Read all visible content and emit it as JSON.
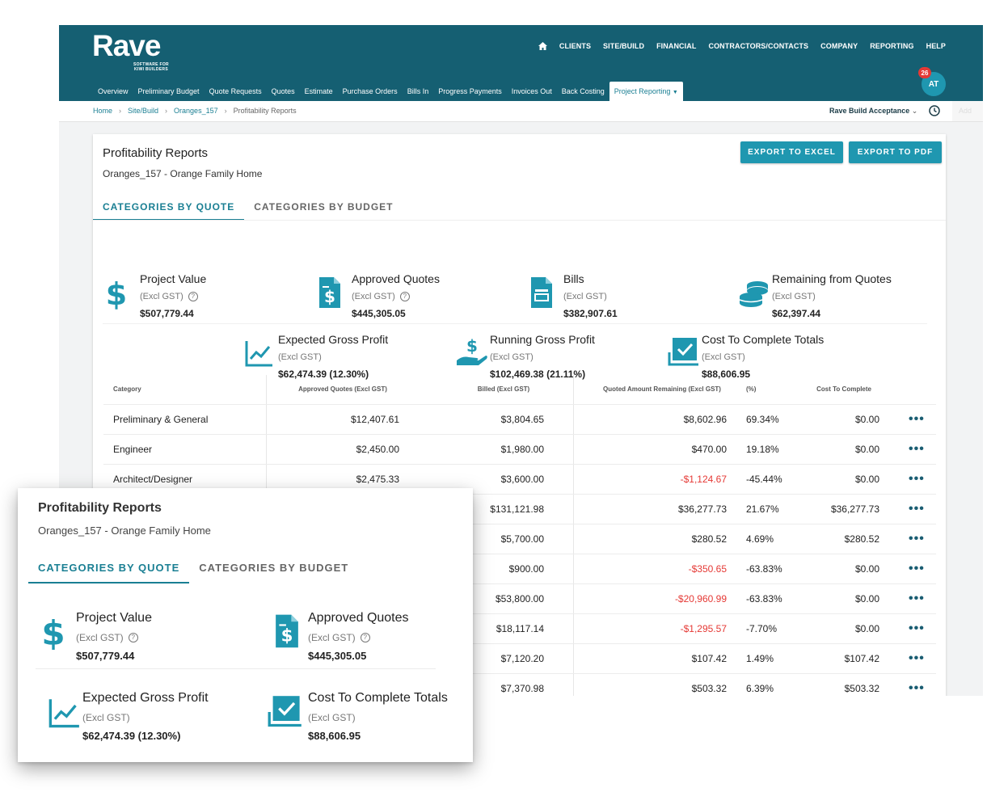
{
  "app": {
    "logo": "Rave",
    "logo_tagline": "SOFTWARE FOR KIWI BUILDERS",
    "main_nav": [
      "CLIENTS",
      "SITE/BUILD",
      "FINANCIAL",
      "CONTRACTORS/CONTACTS",
      "COMPANY",
      "REPORTING",
      "HELP"
    ],
    "sub_nav": [
      "Overview",
      "Preliminary Budget",
      "Quote Requests",
      "Quotes",
      "Estimate",
      "Purchase Orders",
      "Bills In",
      "Progress Payments",
      "Invoices Out",
      "Back Costing",
      "Project Reporting"
    ],
    "sub_nav_active": "Project Reporting",
    "avatar_initials": "AT",
    "notification_count": "26",
    "breadcrumb": [
      "Home",
      "Site/Build",
      "Oranges_157",
      "Profitability Reports"
    ],
    "company_selector": "Rave Build Acceptance",
    "add_tab": "Add",
    "colors": {
      "header": "#155f72",
      "accent": "#1f97b0",
      "negative": "#e53935"
    }
  },
  "report": {
    "title": "Profitability Reports",
    "subtitle": "Oranges_157 - Orange Family Home",
    "export_excel": "EXPORT TO EXCEL",
    "export_pdf": "EXPORT TO PDF",
    "tabs": [
      "CATEGORIES BY QUOTE",
      "CATEGORIES BY BUDGET"
    ],
    "excl": "(Excl GST)",
    "stats": {
      "project_value": {
        "label": "Project Value",
        "value": "$507,779.44",
        "icon": "dollar-icon"
      },
      "approved_quotes": {
        "label": "Approved Quotes",
        "value": "$445,305.05",
        "icon": "document-dollar-icon"
      },
      "bills": {
        "label": "Bills",
        "value": "$382,907.61",
        "icon": "bill-icon"
      },
      "remaining": {
        "label": "Remaining from Quotes",
        "value": "$62,397.44",
        "icon": "coins-icon"
      },
      "expected_gp": {
        "label": "Expected Gross Profit",
        "value": "$62,474.39 (12.30%)",
        "icon": "trend-chart-icon"
      },
      "running_gp": {
        "label": "Running Gross Profit",
        "value": "$102,469.38 (21.11%)",
        "icon": "hand-dollar-icon"
      },
      "cost_to_complete": {
        "label": "Cost To Complete Totals",
        "value": "$88,606.95",
        "icon": "checkbox-icon"
      }
    },
    "table": {
      "headers": [
        "Category",
        "Approved Quotes (Excl GST)",
        "Billed (Excl GST)",
        "Quoted Amount Remaining (Excl GST)",
        "(%)",
        "Cost To Complete"
      ],
      "rows": [
        {
          "category": "Preliminary & General",
          "approved": "$12,407.61",
          "billed": "$3,804.65",
          "remaining": "$8,602.96",
          "pct": "69.34%",
          "ctc": "$0.00",
          "neg": false
        },
        {
          "category": "Engineer",
          "approved": "$2,450.00",
          "billed": "$1,980.00",
          "remaining": "$470.00",
          "pct": "19.18%",
          "ctc": "$0.00",
          "neg": false
        },
        {
          "category": "Architect/Designer",
          "approved": "$2,475.33",
          "billed": "$3,600.00",
          "remaining": "-$1,124.67",
          "pct": "-45.44%",
          "ctc": "$0.00",
          "neg": true
        },
        {
          "category": "",
          "approved": "",
          "billed": "$131,121.98",
          "remaining": "$36,277.73",
          "pct": "21.67%",
          "ctc": "$36,277.73",
          "neg": false
        },
        {
          "category": "",
          "approved": "",
          "billed": "$5,700.00",
          "remaining": "$280.52",
          "pct": "4.69%",
          "ctc": "$280.52",
          "neg": false
        },
        {
          "category": "",
          "approved": "",
          "billed": "$900.00",
          "remaining": "-$350.65",
          "pct": "-63.83%",
          "ctc": "$0.00",
          "neg": true
        },
        {
          "category": "",
          "approved": "",
          "billed": "$53,800.00",
          "remaining": "-$20,960.99",
          "pct": "-63.83%",
          "ctc": "$0.00",
          "neg": true
        },
        {
          "category": "",
          "approved": "",
          "billed": "$18,117.14",
          "remaining": "-$1,295.57",
          "pct": "-7.70%",
          "ctc": "$0.00",
          "neg": true
        },
        {
          "category": "",
          "approved": "",
          "billed": "$7,120.20",
          "remaining": "$107.42",
          "pct": "1.49%",
          "ctc": "$107.42",
          "neg": false
        },
        {
          "category": "",
          "approved": "",
          "billed": "$7,370.98",
          "remaining": "$503.32",
          "pct": "6.39%",
          "ctc": "$503.32",
          "neg": false
        }
      ],
      "row_action": "•••"
    }
  }
}
